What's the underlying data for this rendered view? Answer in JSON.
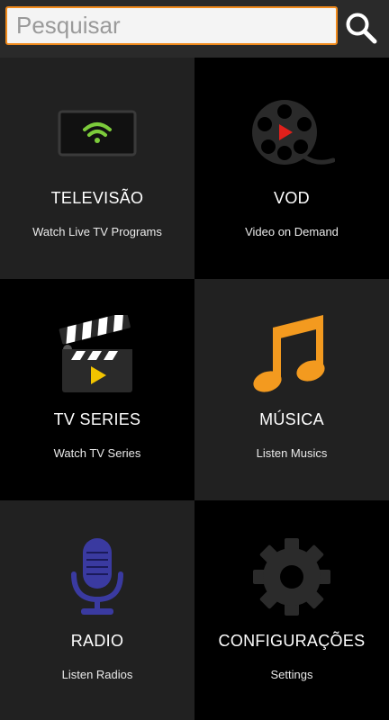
{
  "search": {
    "placeholder": "Pesquisar",
    "value": "",
    "icon": "search-icon"
  },
  "colors": {
    "accent": "#f08a1c",
    "wifi": "#7ccb3b",
    "play_red": "#e0201b",
    "play_yellow": "#f2c400",
    "music": "#f39a1f",
    "mic": "#3a3aa0",
    "gear": "#2b2b2b"
  },
  "menu": [
    {
      "id": "tv",
      "title": "TELEVISÃO",
      "subtitle": "Watch Live TV Programs",
      "icon": "tv-wifi-icon"
    },
    {
      "id": "vod",
      "title": "VOD",
      "subtitle": "Video on Demand",
      "icon": "film-reel-icon"
    },
    {
      "id": "series",
      "title": "TV SERIES",
      "subtitle": "Watch TV Series",
      "icon": "clapperboard-icon"
    },
    {
      "id": "music",
      "title": "MÚSICA",
      "subtitle": "Listen Musics",
      "icon": "music-note-icon"
    },
    {
      "id": "radio",
      "title": "RADIO",
      "subtitle": "Listen Radios",
      "icon": "microphone-icon"
    },
    {
      "id": "settings",
      "title": "CONFIGURAÇÕES",
      "subtitle": "Settings",
      "icon": "gear-icon"
    }
  ]
}
